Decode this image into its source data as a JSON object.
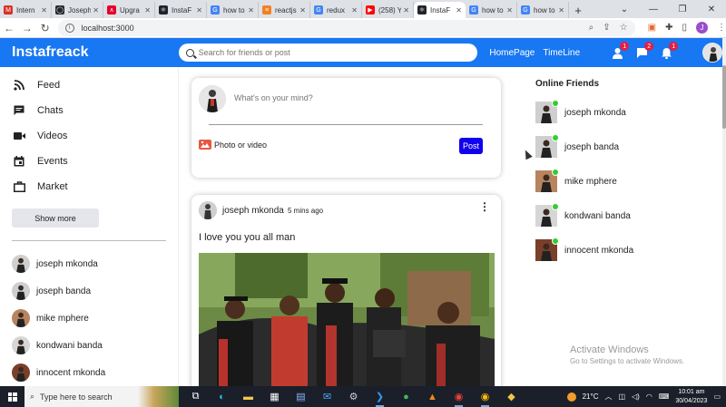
{
  "browser": {
    "tabs": [
      {
        "label": "Intern",
        "color": "#d93025",
        "glyph": "M"
      },
      {
        "label": "Joseph",
        "color": "#24292e",
        "glyph": "◯"
      },
      {
        "label": "Upgra",
        "color": "#e4002b",
        "glyph": "∧"
      },
      {
        "label": "InstaF",
        "color": "#20232a",
        "glyph": "⚛"
      },
      {
        "label": "how to",
        "color": "#4285f4",
        "glyph": "G"
      },
      {
        "label": "reactjs",
        "color": "#f48024",
        "glyph": "≡"
      },
      {
        "label": "redux",
        "color": "#4285f4",
        "glyph": "G"
      },
      {
        "label": "(258) Y",
        "color": "#ff0000",
        "glyph": "▶"
      },
      {
        "label": "InstaF",
        "color": "#20232a",
        "glyph": "⚛"
      },
      {
        "label": "how to",
        "color": "#4285f4",
        "glyph": "G"
      },
      {
        "label": "how to",
        "color": "#4285f4",
        "glyph": "G"
      }
    ],
    "active_tab_index": 8,
    "new_tab_glyph": "+",
    "url": "localhost:3000"
  },
  "app": {
    "logo": "Instafreack",
    "search_placeholder": "Search for friends or post",
    "nav_links": [
      "HomePage",
      "TimeLine"
    ],
    "badges": {
      "friends": "1",
      "messages": "2",
      "notifications": "1"
    },
    "accent_color": "#1877f2"
  },
  "sidebar": {
    "items": [
      {
        "label": "Feed",
        "icon": "rss-icon"
      },
      {
        "label": "Chats",
        "icon": "chat-icon"
      },
      {
        "label": "Videos",
        "icon": "video-camera-icon"
      },
      {
        "label": "Events",
        "icon": "calendar-icon"
      },
      {
        "label": "Market",
        "icon": "briefcase-icon"
      }
    ],
    "show_more": "Show more",
    "friends": [
      "joseph mkonda",
      "joseph banda",
      "mike mphere",
      "kondwani banda",
      "innocent mkonda"
    ]
  },
  "share": {
    "placeholder": "What's on your mind?",
    "option": "Photo or video",
    "post_button": "Post"
  },
  "post": {
    "author": "joseph mkonda",
    "time": "5 mins ago",
    "text": "I love you you all man"
  },
  "rightbar": {
    "title": "Online Friends",
    "friends": [
      "joseph mkonda",
      "joseph banda",
      "mike mphere",
      "kondwani banda",
      "innocent mkonda"
    ]
  },
  "watermark": {
    "line1": "Activate Windows",
    "line2": "Go to Settings to activate Windows."
  },
  "taskbar": {
    "search_placeholder": "Type here to search",
    "temperature": "21°C",
    "time": "10:01 am",
    "date": "30/04/2023"
  }
}
